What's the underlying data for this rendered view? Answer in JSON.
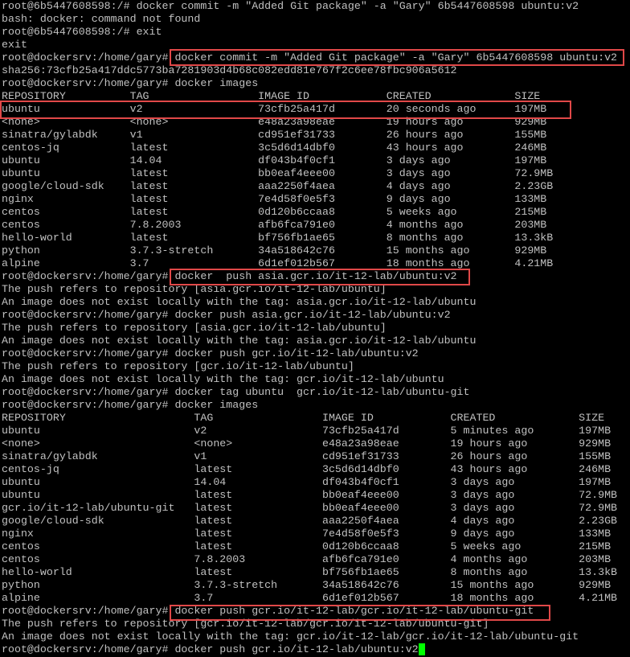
{
  "lines": [
    "root@6b5447608598:/# docker commit -m \"Added Git package\" -a \"Gary\" 6b5447608598 ubuntu:v2",
    "bash: docker: command not found",
    "root@6b5447608598:/# exit",
    "exit",
    "root@dockersrv:/home/gary# docker commit -m \"Added Git package\" -a \"Gary\" 6b5447608598 ubuntu:v2",
    "sha256:73cfb25a417ddc5773ba7281903d4b68c082edd81e767f2c6ee78fbc906a5612",
    "root@dockersrv:/home/gary# docker images",
    "REPOSITORY          TAG                 IMAGE ID            CREATED             SIZE",
    "ubuntu              v2                  73cfb25a417d        20 seconds ago      197MB",
    "<none>              <none>              e48a23a98eae        19 hours ago        929MB",
    "sinatra/gylabdk     v1                  cd951ef31733        26 hours ago        155MB",
    "centos-jq           latest              3c5d6d14dbf0        43 hours ago        246MB",
    "ubuntu              14.04               df043b4f0cf1        3 days ago          197MB",
    "ubuntu              latest              bb0eaf4eee00        3 days ago          72.9MB",
    "google/cloud-sdk    latest              aaa2250f4aea        4 days ago          2.23GB",
    "nginx               latest              7e4d58f0e5f3        9 days ago          133MB",
    "centos              latest              0d120b6ccaa8        5 weeks ago         215MB",
    "centos              7.8.2003            afb6fca791e0        4 months ago        203MB",
    "hello-world         latest              bf756fb1ae65        8 months ago        13.3kB",
    "python              3.7.3-stretch       34a518642c76        15 months ago       929MB",
    "alpine              3.7                 6d1ef012b567        18 months ago       4.21MB",
    "root@dockersrv:/home/gary# docker  push asia.gcr.io/it-12-lab/ubuntu:v2",
    "The push refers to repository [asia.gcr.io/it-12-lab/ubuntu]",
    "An image does not exist locally with the tag: asia.gcr.io/it-12-lab/ubuntu",
    "root@dockersrv:/home/gary# docker push asia.gcr.io/it-12-lab/ubuntu:v2",
    "The push refers to repository [asia.gcr.io/it-12-lab/ubuntu]",
    "An image does not exist locally with the tag: asia.gcr.io/it-12-lab/ubuntu",
    "root@dockersrv:/home/gary# docker push gcr.io/it-12-lab/ubuntu:v2",
    "The push refers to repository [gcr.io/it-12-lab/ubuntu]",
    "An image does not exist locally with the tag: gcr.io/it-12-lab/ubuntu",
    "root@dockersrv:/home/gary# docker tag ubuntu  gcr.io/it-12-lab/ubuntu-git",
    "root@dockersrv:/home/gary# docker images",
    "REPOSITORY                    TAG                 IMAGE ID            CREATED             SIZE",
    "ubuntu                        v2                  73cfb25a417d        5 minutes ago       197MB",
    "<none>                        <none>              e48a23a98eae        19 hours ago        929MB",
    "sinatra/gylabdk               v1                  cd951ef31733        26 hours ago        155MB",
    "centos-jq                     latest              3c5d6d14dbf0        43 hours ago        246MB",
    "ubuntu                        14.04               df043b4f0cf1        3 days ago          197MB",
    "ubuntu                        latest              bb0eaf4eee00        3 days ago          72.9MB",
    "gcr.io/it-12-lab/ubuntu-git   latest              bb0eaf4eee00        3 days ago          72.9MB",
    "google/cloud-sdk              latest              aaa2250f4aea        4 days ago          2.23GB",
    "nginx                         latest              7e4d58f0e5f3        9 days ago          133MB",
    "centos                        latest              0d120b6ccaa8        5 weeks ago         215MB",
    "centos                        7.8.2003            afb6fca791e0        4 months ago        203MB",
    "hello-world                   latest              bf756fb1ae65        8 months ago        13.3kB",
    "python                        3.7.3-stretch       34a518642c76        15 months ago       929MB",
    "alpine                        3.7                 6d1ef012b567        18 months ago       4.21MB",
    "root@dockersrv:/home/gary# docker push gcr.io/it-12-lab/gcr.io/it-12-lab/ubuntu-git",
    "The push refers to repository [gcr.io/it-12-lab/gcr.io/it-12-lab/ubuntu-git]",
    "An image does not exist locally with the tag: gcr.io/it-12-lab/gcr.io/it-12-lab/ubuntu-git",
    "root@dockersrv:/home/gary# docker push gcr.io/it-12-lab/ubuntu:v2"
  ],
  "colors": {
    "background": "#000000",
    "text": "#c0c0c0",
    "highlight_border": "#e04848",
    "cursor": "#00ff00"
  }
}
